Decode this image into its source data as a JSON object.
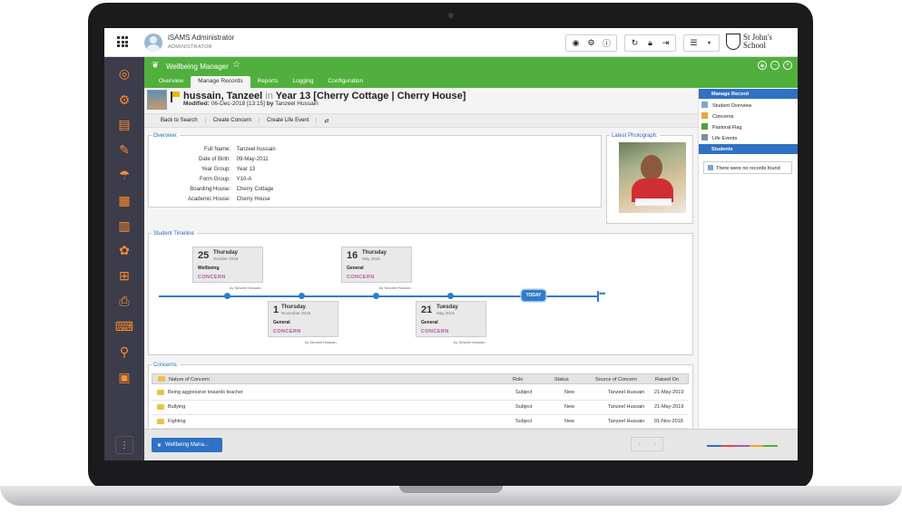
{
  "user": {
    "name": "iSAMS Administrator",
    "role": "ADMINISTRATOR"
  },
  "school": {
    "name_line1": "St John's",
    "name_line2": "School"
  },
  "module": {
    "title": "Wellbeing Manager",
    "tabs": [
      "Overview",
      "Manage Records",
      "Reports",
      "Logging",
      "Configuration"
    ],
    "active_tab": "Manage Records"
  },
  "student": {
    "name": "hussain, Tanzeel",
    "in_word": "in",
    "year_house": "Year 13 [Cherry Cottage | Cherry House]",
    "modified_label": "Modified:",
    "modified_value": "06-Dec-2018 [13:15]",
    "by_word": "by",
    "modified_by": "Tanzeel Hussain"
  },
  "actions": [
    "Back to Search",
    "Create Concern",
    "Create Life Event"
  ],
  "overview": {
    "legend": "Overview:",
    "rows": [
      {
        "label": "Full Name:",
        "value": "Tanzeel hussain"
      },
      {
        "label": "Date of Birth:",
        "value": "09-May-2011"
      },
      {
        "label": "Year Group:",
        "value": "Year 13"
      },
      {
        "label": "Form Group:",
        "value": "Y10-A"
      },
      {
        "label": "Boarding House:",
        "value": "Cherry Cottage"
      },
      {
        "label": "Academic House:",
        "value": "Cherry House"
      }
    ]
  },
  "photo": {
    "legend": "Latest Photograph:"
  },
  "timeline": {
    "legend": "Student Timeline:",
    "today_label": "TODAY",
    "more_label": "•••",
    "events": [
      {
        "day": "25",
        "weekday": "Thursday",
        "month": "October 2018",
        "category": "Wellbeing",
        "type": "CONCERN",
        "by": "by Tanzeel Hussain"
      },
      {
        "day": "1",
        "weekday": "Thursday",
        "month": "November 2018",
        "category": "General",
        "type": "CONCERN",
        "by": "by Tanzeel Hussain"
      },
      {
        "day": "16",
        "weekday": "Thursday",
        "month": "May 2019",
        "category": "General",
        "type": "CONCERN",
        "by": "by Tanzeel Hussain"
      },
      {
        "day": "21",
        "weekday": "Tuesday",
        "month": "May 2019",
        "category": "General",
        "type": "CONCERN",
        "by": "by Tanzeel Hussain"
      }
    ]
  },
  "concerns": {
    "legend": "Concerns:",
    "columns": [
      "Nature of Concern",
      "Role",
      "Status",
      "Source of Concern",
      "Raised On"
    ],
    "rows": [
      {
        "nature": "Being aggressive towards teacher",
        "role": "Subject",
        "status": "New",
        "source": "Tanzeel Hussain",
        "raised": "21-May-2019"
      },
      {
        "nature": "Bullying",
        "role": "Subject",
        "status": "New",
        "source": "Tanzeel Hussain",
        "raised": "21-May-2019"
      },
      {
        "nature": "Fighting",
        "role": "Subject",
        "status": "New",
        "source": "Tanzeel Hussain",
        "raised": "01-Nov-2018"
      }
    ]
  },
  "right_panel": {
    "manage_header": "Manage Record",
    "items": [
      "Student Overview",
      "Concerns",
      "Pastoral Flag",
      "Life Events"
    ],
    "students_header": "Students",
    "empty_message": "There were no records found"
  },
  "taskbar": {
    "task_label": "Wellbeing Mana..."
  },
  "colors": {
    "accent_green": "#51b03d",
    "accent_blue": "#2f71c3",
    "sidebar": "#3c3c4a",
    "icon_orange": "#ff8b2f",
    "concern_purple": "#a95aa6"
  }
}
